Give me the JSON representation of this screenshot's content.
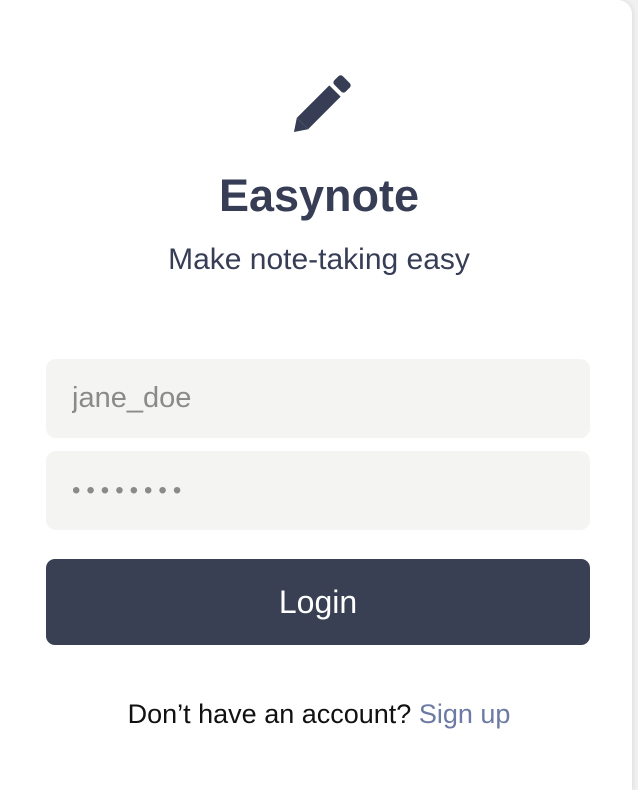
{
  "app": {
    "title": "Easynote",
    "tagline": "Make note-taking easy",
    "logo_icon": "pencil-icon"
  },
  "form": {
    "username": {
      "placeholder": "jane_doe",
      "value": ""
    },
    "password": {
      "value": "••••••••"
    },
    "login_label": "Login"
  },
  "footer": {
    "prompt": "Don’t have an account?",
    "signup_label": "Sign up"
  },
  "colors": {
    "primary": "#3a4054",
    "heading": "#363d55",
    "field_bg": "#f4f4f2",
    "link": "#6d7aa3"
  }
}
